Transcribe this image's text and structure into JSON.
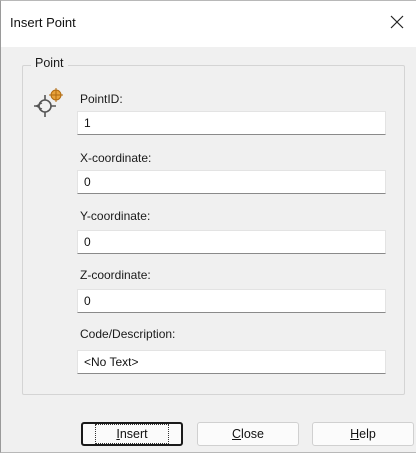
{
  "window": {
    "title": "Insert Point"
  },
  "group": {
    "label": "Point"
  },
  "fields": {
    "point_id": {
      "label": "PointID:",
      "value": "1"
    },
    "x": {
      "label": "X-coordinate:",
      "value": "0"
    },
    "y": {
      "label": "Y-coordinate:",
      "value": "0"
    },
    "z": {
      "label": "Z-coordinate:",
      "value": "0"
    },
    "code": {
      "label": "Code/Description:",
      "value": "<No Text>"
    }
  },
  "buttons": {
    "insert": {
      "mnemonic": "I",
      "rest": "nsert"
    },
    "close": {
      "mnemonic": "C",
      "rest": "lose"
    },
    "help": {
      "mnemonic": "H",
      "rest": "elp"
    }
  },
  "icons": {
    "close": "close-icon",
    "point": "point-target-icon"
  },
  "colors": {
    "icon_orange": "#e8a23a"
  }
}
